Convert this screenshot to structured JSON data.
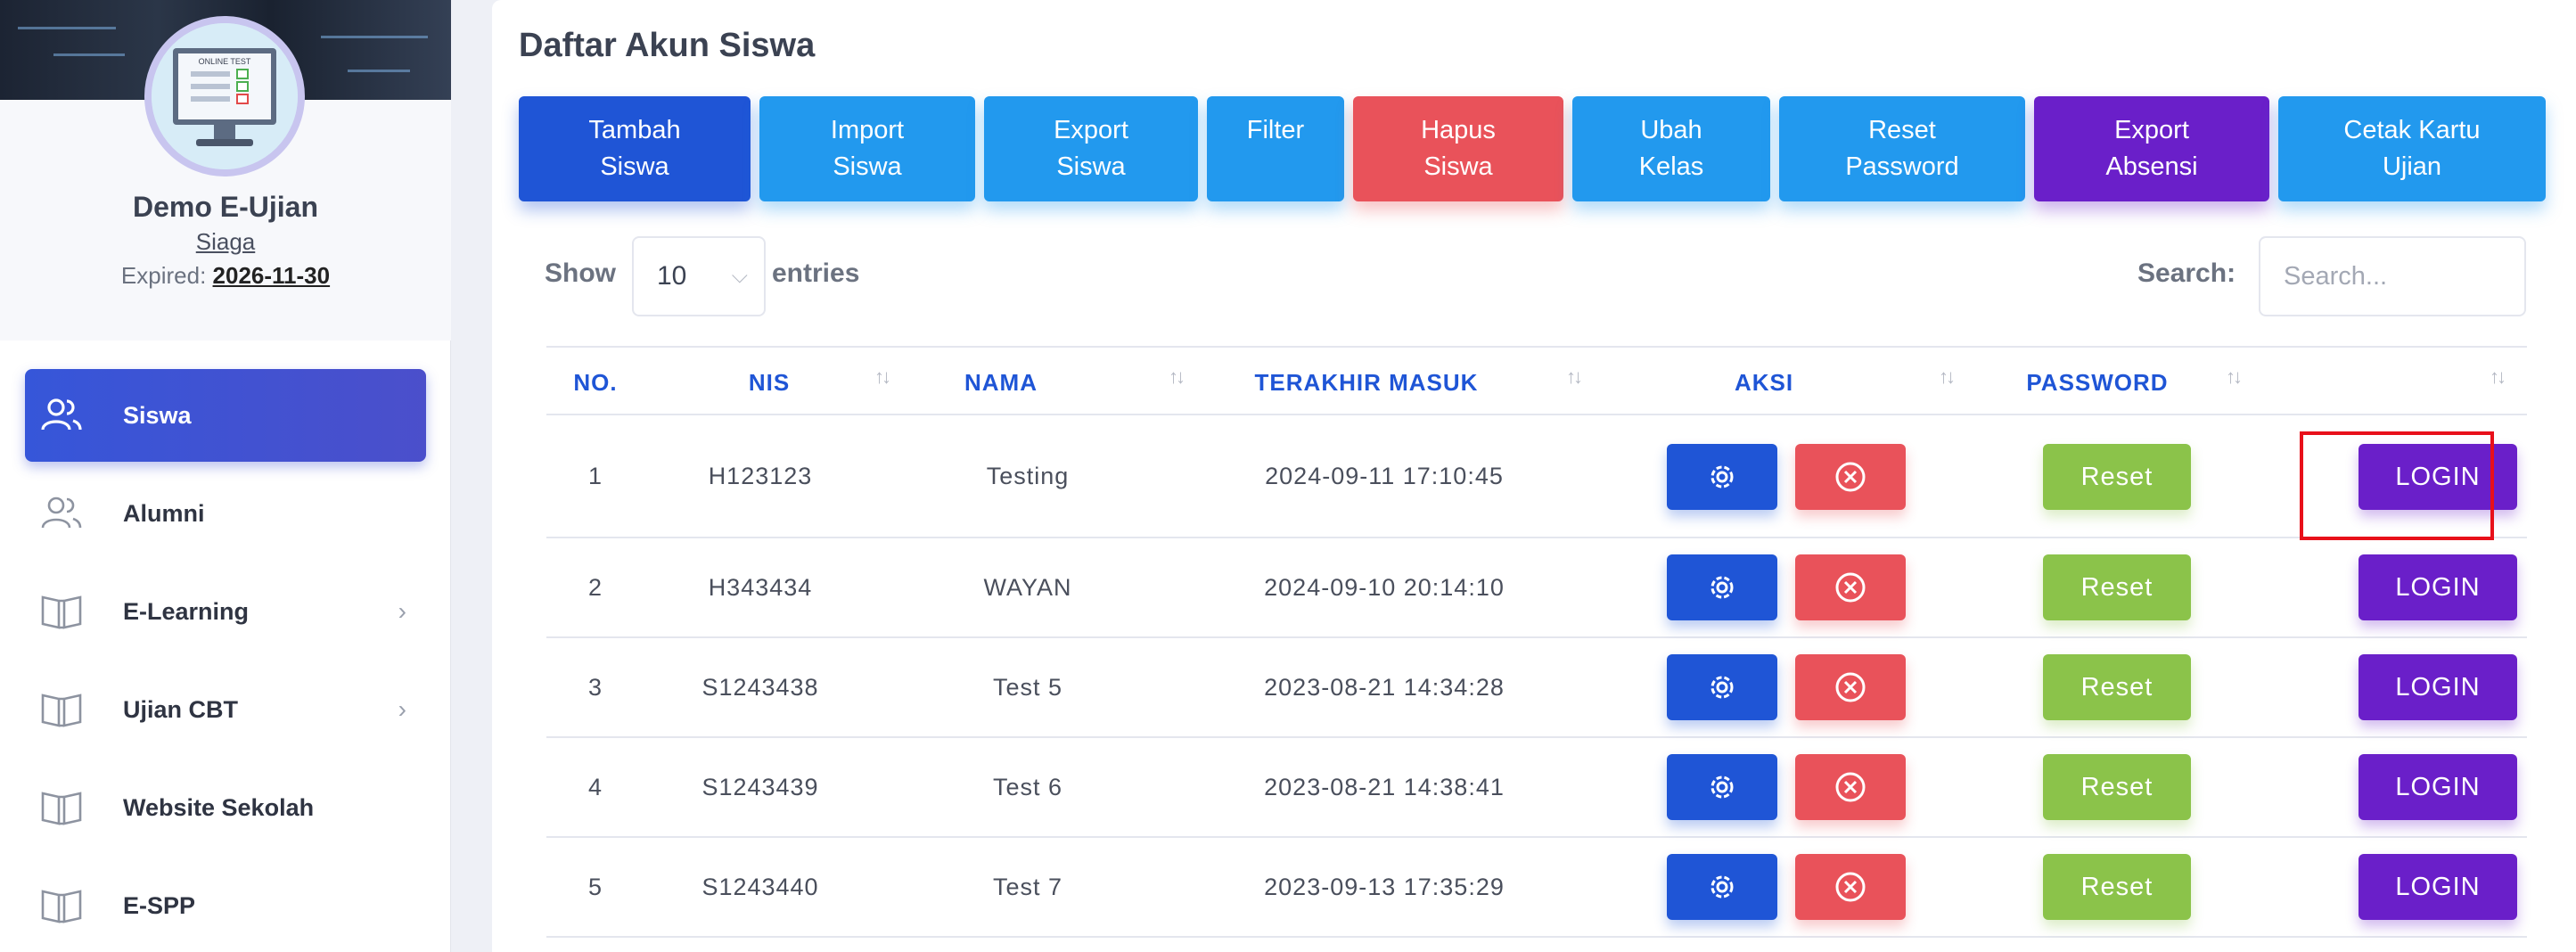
{
  "profile": {
    "name": "Demo E-Ujian",
    "level": "Siaga",
    "expired_label": "Expired:",
    "expired_date": "2026-11-30",
    "avatar_caption": "ONLINE TEST"
  },
  "sidebar": {
    "items": [
      {
        "label": "Siswa",
        "icon": "users-icon",
        "active": true,
        "has_submenu": false
      },
      {
        "label": "Alumni",
        "icon": "users-icon",
        "active": false,
        "has_submenu": false
      },
      {
        "label": "E-Learning",
        "icon": "book-icon",
        "active": false,
        "has_submenu": true
      },
      {
        "label": "Ujian CBT",
        "icon": "book-icon",
        "active": false,
        "has_submenu": true
      },
      {
        "label": "Website Sekolah",
        "icon": "book-icon",
        "active": false,
        "has_submenu": false
      },
      {
        "label": "E-SPP",
        "icon": "book-icon",
        "active": false,
        "has_submenu": false
      }
    ]
  },
  "page": {
    "title": "Daftar Akun Siswa"
  },
  "toolbar": {
    "buttons": [
      {
        "line1": "Tambah",
        "line2": "Siswa",
        "color": "#1f55d6"
      },
      {
        "line1": "Import",
        "line2": "Siswa",
        "color": "#2299ee"
      },
      {
        "line1": "Export",
        "line2": "Siswa",
        "color": "#2299ee"
      },
      {
        "line1": "Filter",
        "line2": "",
        "color": "#2299ee"
      },
      {
        "line1": "Hapus",
        "line2": "Siswa",
        "color": "#e9525a"
      },
      {
        "line1": "Ubah",
        "line2": "Kelas",
        "color": "#2299ee"
      },
      {
        "line1": "Reset",
        "line2": "Password",
        "color": "#2299ee"
      },
      {
        "line1": "Export",
        "line2": "Absensi",
        "color": "#6a1fc9"
      },
      {
        "line1": "Cetak Kartu",
        "line2": "Ujian",
        "color": "#2299ee"
      }
    ]
  },
  "table_controls": {
    "show_label": "Show",
    "entries_value": "10",
    "entries_label": "entries",
    "search_label": "Search:",
    "search_placeholder": "Search..."
  },
  "table": {
    "columns": [
      "NO.",
      "NIS",
      "NAMA",
      "TERAKHIR MASUK",
      "AKSI",
      "PASSWORD",
      ""
    ],
    "rows": [
      {
        "no": "1",
        "nis": "H123123",
        "nama": "Testing",
        "terakhir_masuk": "2024-09-11 17:10:45",
        "reset_label": "Reset",
        "login_label": "LOGIN"
      },
      {
        "no": "2",
        "nis": "H343434",
        "nama": "WAYAN",
        "terakhir_masuk": "2024-09-10 20:14:10",
        "reset_label": "Reset",
        "login_label": "LOGIN"
      },
      {
        "no": "3",
        "nis": "S1243438",
        "nama": "Test 5",
        "terakhir_masuk": "2023-08-21 14:34:28",
        "reset_label": "Reset",
        "login_label": "LOGIN"
      },
      {
        "no": "4",
        "nis": "S1243439",
        "nama": "Test 6",
        "terakhir_masuk": "2023-08-21 14:38:41",
        "reset_label": "Reset",
        "login_label": "LOGIN"
      },
      {
        "no": "5",
        "nis": "S1243440",
        "nama": "Test 7",
        "terakhir_masuk": "2023-09-13 17:35:29",
        "reset_label": "Reset",
        "login_label": "LOGIN"
      }
    ]
  },
  "colors": {
    "primary": "#1f55d6",
    "info": "#2299ee",
    "danger": "#e9525a",
    "success": "#8bc34a",
    "purple": "#6a1fc9",
    "highlight": "#e8101a"
  }
}
